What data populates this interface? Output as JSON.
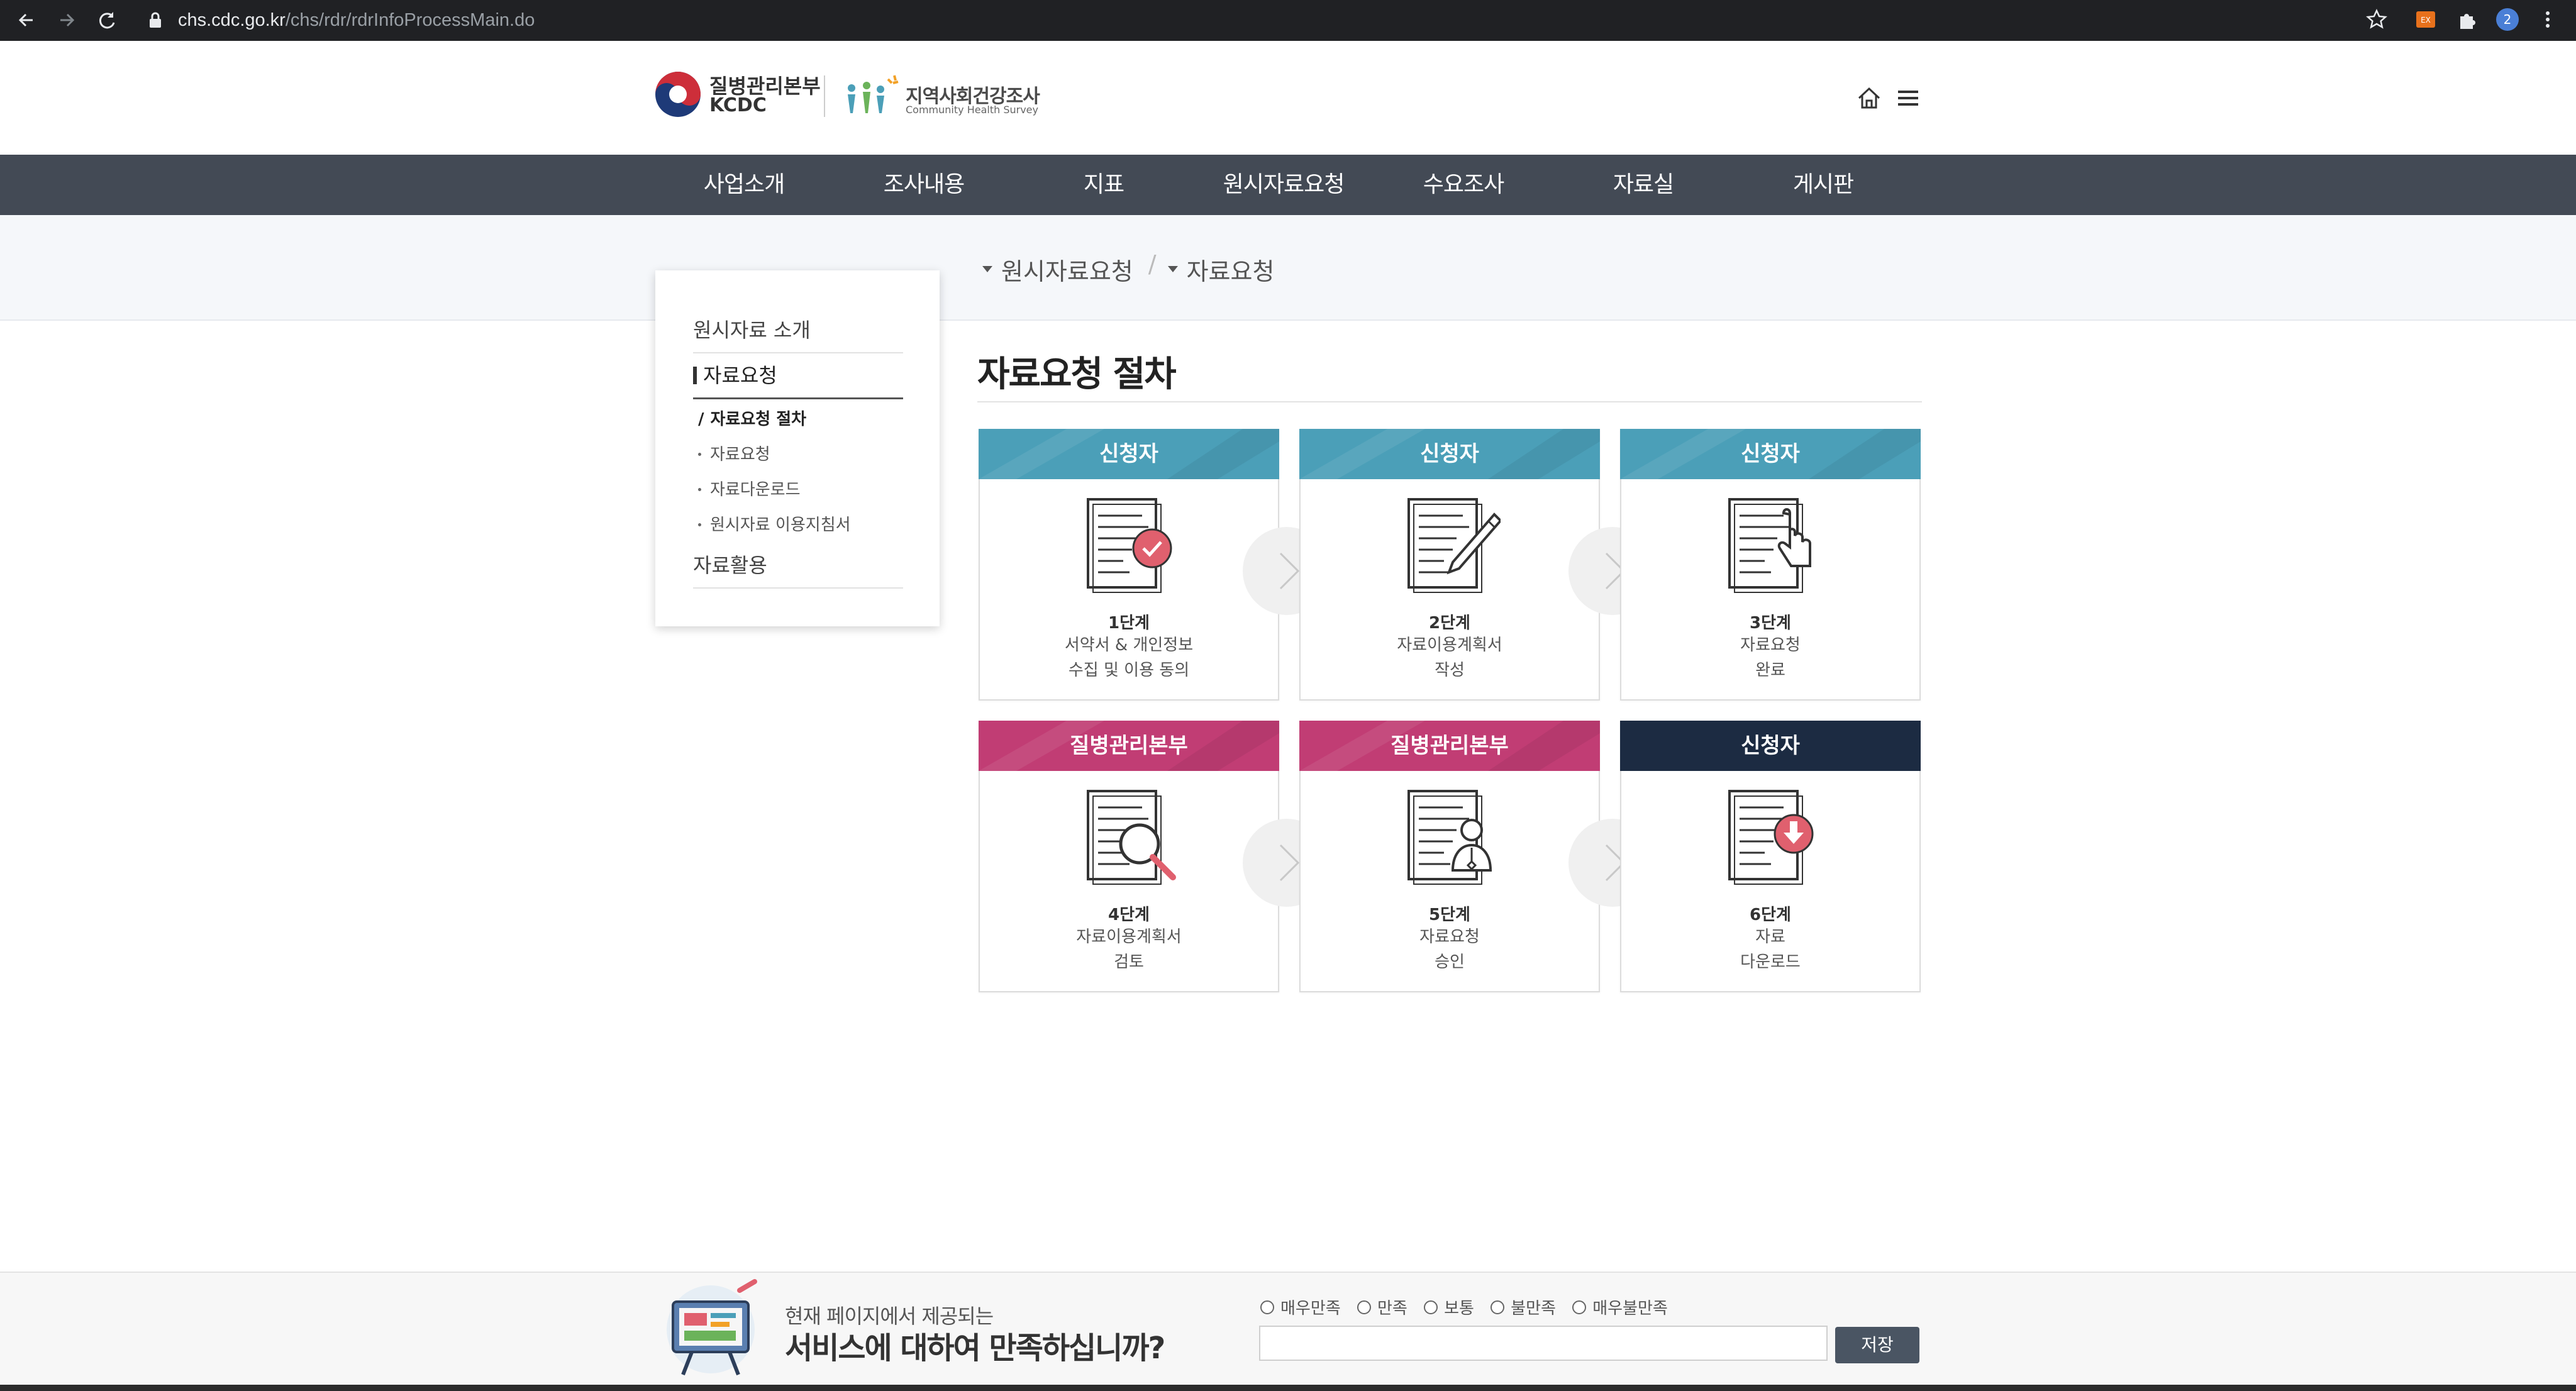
{
  "browser": {
    "url_host": "chs.cdc.go.kr",
    "url_path": "/chs/rdr/rdrInfoProcessMain.do",
    "profile_badge": "2"
  },
  "header": {
    "kcdc_ko": "질병관리본부",
    "kcdc_en": "KCDC",
    "chs_ko": "지역사회건강조사",
    "chs_en": "Community Health Survey"
  },
  "gnb": {
    "items": [
      "사업소개",
      "조사내용",
      "지표",
      "원시자료요청",
      "수요조사",
      "자료실",
      "게시판"
    ]
  },
  "breadcrumb": {
    "items": [
      "원시자료요청",
      "자료요청"
    ]
  },
  "snb": {
    "intro": "원시자료 소개",
    "request": "자료요청",
    "subs": [
      "자료요청 절차",
      "자료요청",
      "자료다운로드",
      "원시자료 이용지침서"
    ],
    "usage": "자료활용"
  },
  "content": {
    "title": "자료요청 절차",
    "cards": [
      {
        "head": "신청자",
        "step": "1단계",
        "line1": "서약서 & 개인정보",
        "line2": "수집 및 이용 동의",
        "icon": "document-check-icon",
        "color": "#4b9fb8"
      },
      {
        "head": "신청자",
        "step": "2단계",
        "line1": "자료이용계획서",
        "line2": "작성",
        "icon": "document-pen-icon",
        "color": "#4b9fb8"
      },
      {
        "head": "신청자",
        "step": "3단계",
        "line1": "자료요청",
        "line2": "완료",
        "icon": "document-click-icon",
        "color": "#4b9fb8"
      },
      {
        "head": "질병관리본부",
        "step": "4단계",
        "line1": "자료이용계획서",
        "line2": "검토",
        "icon": "document-magnifier-icon",
        "color": "#c13d74"
      },
      {
        "head": "질병관리본부",
        "step": "5단계",
        "line1": "자료요청",
        "line2": "승인",
        "icon": "document-person-icon",
        "color": "#c13d74"
      },
      {
        "head": "신청자",
        "step": "6단계",
        "line1": "자료",
        "line2": "다운로드",
        "icon": "document-download-icon",
        "color": "#1c2b42"
      }
    ]
  },
  "survey": {
    "line1": "현재 페이지에서 제공되는",
    "line2": "서비스에 대하여 만족하십니까?",
    "options": [
      "매우만족",
      "만족",
      "보통",
      "불만족",
      "매우불만족"
    ],
    "input_value": "",
    "save_label": "저장"
  }
}
